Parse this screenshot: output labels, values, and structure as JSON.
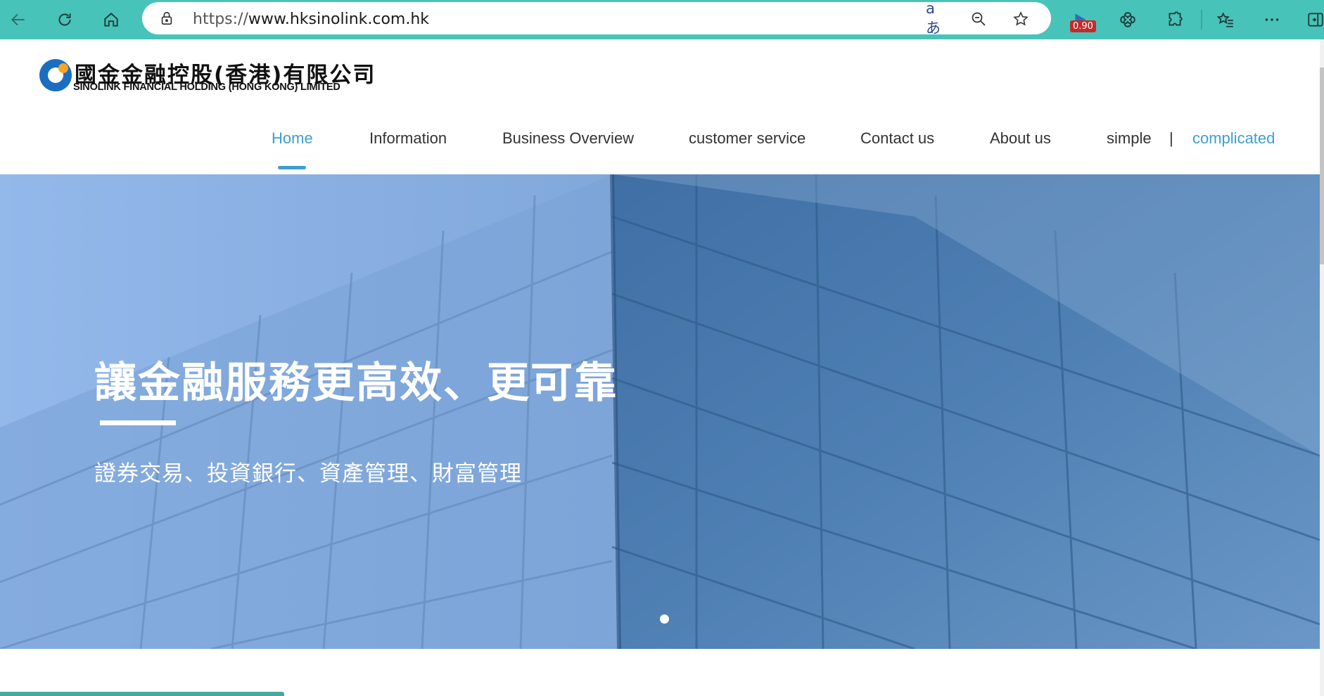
{
  "browser": {
    "url_prefix": "https://",
    "url_host": "www.hksinolink.com.hk",
    "translate_glyph": "aあ",
    "extension_badge": "0.90",
    "accent_color": "#48c3b9"
  },
  "logo": {
    "name_cn": "國金金融控股(香港)有限公司",
    "name_en": "SINOLINK FINANCIAL HOLDING (HONG KONG) LIMITED"
  },
  "nav": {
    "items": [
      {
        "label": "Home",
        "active": true
      },
      {
        "label": "Information"
      },
      {
        "label": "Business Overview"
      },
      {
        "label": "customer service"
      },
      {
        "label": "Contact us"
      },
      {
        "label": "About us"
      }
    ],
    "lang_simple": "simple",
    "lang_separator": "|",
    "lang_complicated": "complicated",
    "active_color": "#3d9fd0"
  },
  "hero": {
    "title": "讓金融服務更高效、更可靠",
    "subtitle": "證券交易、投資銀行、資產管理、財富管理",
    "slide_count": 1,
    "active_slide": 1
  }
}
